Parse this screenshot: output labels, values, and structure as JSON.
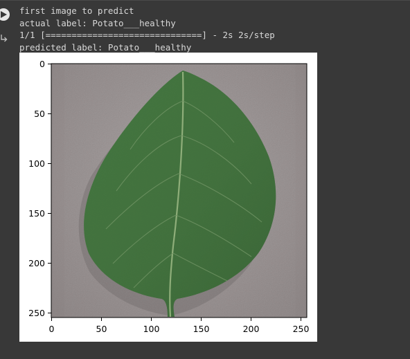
{
  "output": {
    "lines": [
      "first image to predict",
      "actual label: Potato___healthy",
      "1/1 [==============================] - 2s 2s/step",
      "predicted label: Potato___healthy"
    ]
  },
  "figure": {
    "image_subject": "potato leaf on gray background",
    "x_ticks": [
      "0",
      "50",
      "100",
      "150",
      "200",
      "250"
    ],
    "y_ticks": [
      "0",
      "50",
      "100",
      "150",
      "200",
      "250"
    ],
    "x_range": [
      0,
      255
    ],
    "y_range": [
      0,
      255
    ]
  },
  "colors": {
    "background": "#383838",
    "text": "#d8d8d8",
    "leaf": "#3f6b3a",
    "surface": "#9a9292"
  },
  "icons": {
    "run": "play-circle-icon",
    "output": "output-arrow-icon"
  }
}
